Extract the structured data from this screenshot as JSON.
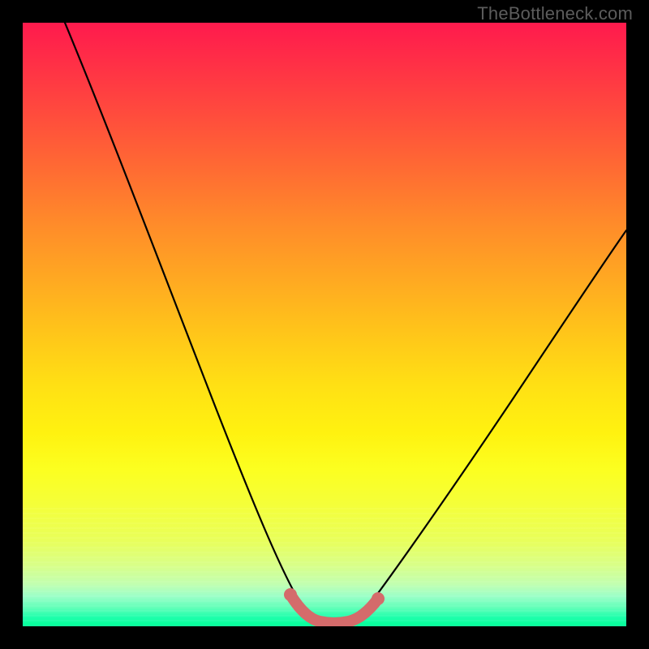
{
  "watermark": {
    "text": "TheBottleneck.com"
  },
  "colors": {
    "curve_stroke": "#000000",
    "rosy_stroke": "#d46b6b",
    "rosy_fill": "#d46b6b"
  },
  "chart_data": {
    "type": "line",
    "title": "",
    "xlabel": "",
    "ylabel": "",
    "xlim": [
      0,
      100
    ],
    "ylim": [
      0,
      100
    ],
    "grid": false,
    "legend": null,
    "series": [
      {
        "name": "bottleneck-curve",
        "x": [
          0,
          6,
          12,
          18,
          24,
          30,
          36,
          40,
          44,
          46,
          48,
          50,
          52,
          54,
          58,
          64,
          72,
          82,
          92,
          100
        ],
        "y": [
          100,
          88,
          76,
          64,
          52,
          40,
          28,
          18,
          10,
          5,
          2,
          1,
          1,
          2,
          6,
          14,
          26,
          40,
          52,
          60
        ]
      },
      {
        "name": "sweet-spot-highlight",
        "x": [
          43,
          46,
          48,
          50,
          52,
          54,
          57
        ],
        "y": [
          8,
          3,
          1,
          1,
          1,
          2,
          6
        ]
      }
    ],
    "annotations": []
  }
}
